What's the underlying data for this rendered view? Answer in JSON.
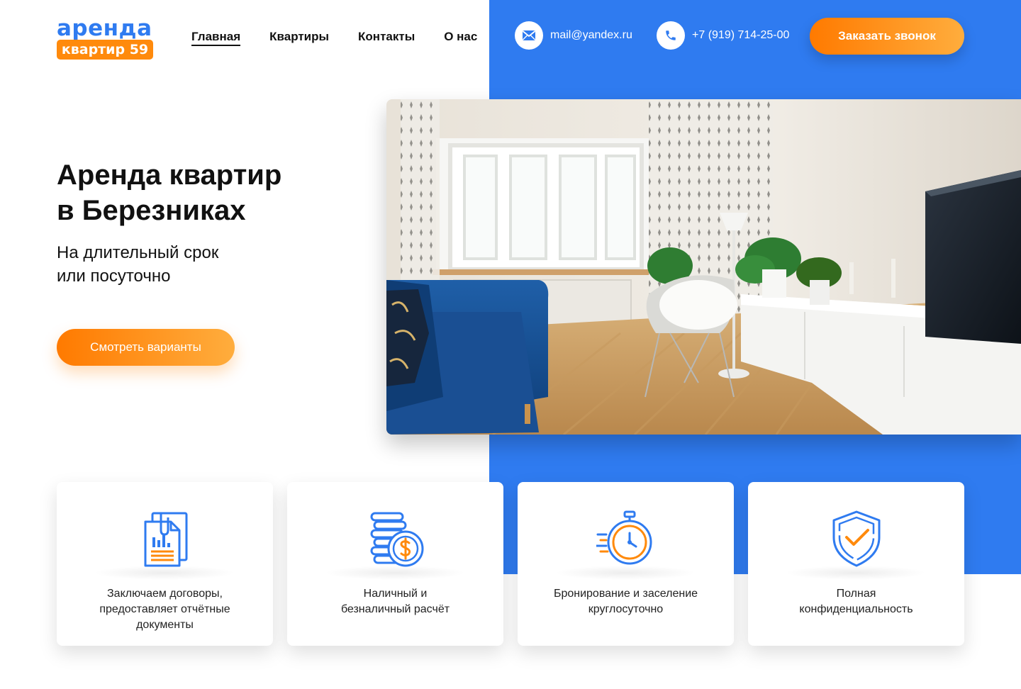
{
  "brand": {
    "logo_top": "аренда",
    "logo_bottom": "квартир 59",
    "primary_color": "#2f7bf0",
    "accent_color": "#ff8a0c"
  },
  "nav": {
    "items": [
      {
        "label": "Главная",
        "active": true
      },
      {
        "label": "Квартиры",
        "active": false
      },
      {
        "label": "Контакты",
        "active": false
      },
      {
        "label": "О нас",
        "active": false
      }
    ]
  },
  "contacts": {
    "email": "mail@yandex.ru",
    "email_icon": "mail-icon",
    "phone": "+7 (919) 714-25-00",
    "phone_icon": "phone-icon"
  },
  "header": {
    "call_button": "Заказать звонок"
  },
  "hero": {
    "title_line1": "Аренда квартир",
    "title_line2": "в Березниках",
    "subtitle_line1": "На длительный срок",
    "subtitle_line2": "или посуточно",
    "cta": "Смотреть варианты"
  },
  "features": [
    {
      "icon": "documents-icon",
      "line1": "Заключаем договоры,",
      "line2": "предоставляет отчётные",
      "line3": "документы"
    },
    {
      "icon": "coins-icon",
      "line1": "Наличный и",
      "line2": "безналичный расчёт",
      "line3": ""
    },
    {
      "icon": "stopwatch-icon",
      "line1": "Бронирование и заселение",
      "line2": "круглосуточно",
      "line3": ""
    },
    {
      "icon": "shield-check-icon",
      "line1": "Полная",
      "line2": "конфиденциальность",
      "line3": ""
    }
  ]
}
